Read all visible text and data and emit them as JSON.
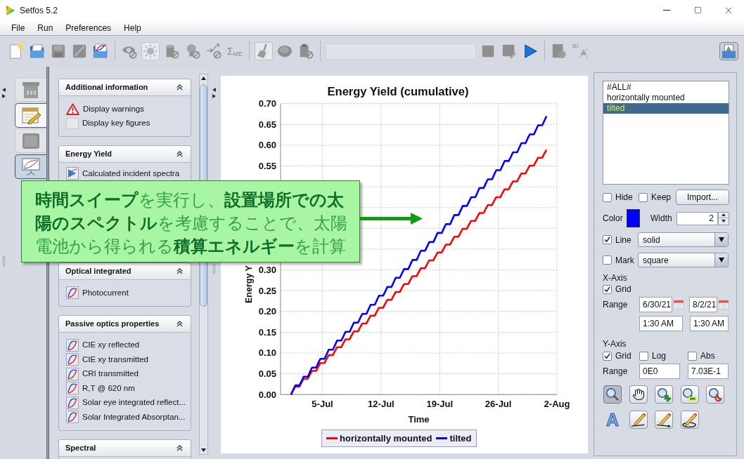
{
  "window": {
    "title": "Setfos 5.2"
  },
  "menu": [
    "File",
    "Run",
    "Preferences",
    "Help"
  ],
  "toolbar": {
    "items": [
      {
        "kind": "button",
        "disabled": false,
        "pressed": false
      },
      {
        "kind": "button",
        "disabled": false,
        "pressed": false
      },
      {
        "kind": "button",
        "disabled": true,
        "pressed": false
      },
      {
        "kind": "button",
        "disabled": true,
        "pressed": false
      },
      {
        "kind": "button",
        "disabled": false,
        "pressed": false
      },
      {
        "kind": "separator"
      },
      {
        "kind": "button",
        "disabled": true,
        "pressed": false
      },
      {
        "kind": "button",
        "disabled": true,
        "pressed": true
      },
      {
        "kind": "button",
        "disabled": true,
        "pressed": false
      },
      {
        "kind": "button",
        "disabled": true,
        "pressed": false
      },
      {
        "kind": "button",
        "disabled": true,
        "pressed": false
      },
      {
        "kind": "button",
        "disabled": true,
        "pressed": false,
        "label": "Σ$_{ME}$"
      },
      {
        "kind": "separator"
      },
      {
        "kind": "button",
        "disabled": true,
        "pressed": true
      },
      {
        "kind": "button",
        "disabled": true,
        "pressed": false
      },
      {
        "kind": "button",
        "disabled": true,
        "pressed": false
      },
      {
        "kind": "separator"
      },
      {
        "kind": "field",
        "disabled": true
      },
      {
        "kind": "button",
        "disabled": true,
        "pressed": false
      },
      {
        "kind": "button",
        "disabled": true,
        "pressed": false
      },
      {
        "kind": "button",
        "disabled": false,
        "pressed": false
      },
      {
        "kind": "separator"
      },
      {
        "kind": "button",
        "disabled": true,
        "pressed": false
      },
      {
        "kind": "button",
        "disabled": true,
        "pressed": false,
        "label": "3D"
      }
    ],
    "right_button": {
      "disabled": false,
      "pressed": true
    }
  },
  "view_tabs": [
    {
      "selected": false,
      "disabled": true
    },
    {
      "selected": false,
      "disabled": false
    },
    {
      "selected": false,
      "disabled": true
    },
    {
      "selected": true,
      "disabled": false
    }
  ],
  "sidebar": {
    "sections": [
      {
        "title": "Additional information",
        "expanded": true,
        "items": [
          {
            "kind": "warning",
            "label": "Display warnings"
          },
          {
            "kind": "blank",
            "label": "Display key figures"
          }
        ]
      },
      {
        "title": "Energy Yield",
        "expanded": true,
        "items": [
          {
            "kind": "spectrum",
            "label": "Calculated incident spectra"
          }
        ]
      },
      {
        "title": "Optical integrated",
        "expanded": true,
        "items": [
          {
            "kind": "plot",
            "label": "Photocurrent"
          }
        ]
      },
      {
        "title": "Passive optics properties",
        "expanded": true,
        "items": [
          {
            "kind": "plot",
            "label": "CIE xy reflected"
          },
          {
            "kind": "plot",
            "label": "CIE xy transmitted"
          },
          {
            "kind": "plot",
            "label": "CRI transmitted"
          },
          {
            "kind": "plot",
            "label": "R,T @ 620 nm"
          },
          {
            "kind": "plot",
            "label": "Solar eye integrated reflect..."
          },
          {
            "kind": "plot",
            "label": "Solar Integrated Absorptan..."
          }
        ]
      },
      {
        "title": "Spectral",
        "expanded": true
      }
    ]
  },
  "chart": {
    "chart_data": {
      "type": "line",
      "title": "Energy Yield (cumulative)",
      "xlabel": "Time",
      "ylabel": "Energy Y",
      "grid": true,
      "legend": "bottom",
      "categories": [
        null,
        null,
        null,
        null,
        null,
        null,
        null,
        null,
        null,
        null,
        null,
        null,
        null,
        null,
        null,
        null,
        null,
        null,
        null,
        null,
        "5-Jul",
        null,
        null,
        null,
        null,
        null,
        null,
        null,
        null,
        null,
        null,
        null,
        null,
        null,
        null,
        null,
        null,
        null,
        null,
        null,
        null,
        null,
        null,
        null,
        null,
        null,
        null,
        null,
        "12-Jul",
        null,
        null,
        null,
        null,
        null,
        null,
        null,
        null,
        null,
        null,
        null,
        null,
        null,
        null,
        null,
        null,
        null,
        null,
        null,
        null,
        null,
        null,
        null,
        null,
        null,
        null,
        null,
        "19-Jul",
        null,
        null,
        null,
        null,
        null,
        null,
        null,
        null,
        null,
        null,
        null,
        null,
        null,
        null,
        null,
        null,
        null,
        null,
        null,
        null,
        null,
        null,
        null,
        null,
        null,
        null,
        null,
        "26-Jul",
        null,
        null,
        null,
        null,
        null,
        null,
        null,
        null,
        null,
        null,
        null,
        null,
        null,
        null,
        null,
        null,
        null,
        null,
        null,
        null,
        null,
        null,
        null,
        null,
        null,
        null,
        null,
        "2-Aug"
      ],
      "series": [
        {
          "name": "horizontally mounted",
          "color": "#ff0000",
          "values": [
            null,
            null,
            null,
            null,
            null,
            0,
            0.01,
            0.019,
            0.019,
            0.019,
            0.029,
            0.038,
            0.038,
            0.038,
            0.048,
            0.057,
            0.057,
            0.057,
            0.067,
            0.076,
            0.076,
            0.076,
            0.086,
            0.095,
            0.095,
            0.095,
            0.105,
            0.114,
            0.114,
            0.114,
            0.124,
            0.133,
            0.133,
            0.133,
            0.143,
            0.152,
            0.152,
            0.152,
            0.162,
            0.171,
            0.171,
            0.171,
            0.181,
            0.19,
            0.19,
            0.19,
            0.2,
            0.209,
            0.209,
            0.209,
            0.219,
            0.228,
            0.228,
            0.228,
            0.238,
            0.247,
            0.247,
            0.247,
            0.257,
            0.266,
            0.266,
            0.266,
            0.276,
            0.285,
            0.285,
            0.285,
            0.295,
            0.304,
            0.304,
            0.304,
            0.314,
            0.323,
            0.323,
            0.323,
            0.333,
            0.342,
            0.342,
            0.342,
            0.352,
            0.361,
            0.361,
            0.361,
            0.371,
            0.38,
            0.38,
            0.38,
            0.39,
            0.399,
            0.399,
            0.399,
            0.409,
            0.418,
            0.418,
            0.418,
            0.428,
            0.437,
            0.437,
            0.437,
            0.447,
            0.456,
            0.456,
            0.456,
            0.466,
            0.475,
            0.475,
            0.475,
            0.485,
            0.494,
            0.494,
            0.494,
            0.504,
            0.513,
            0.513,
            0.513,
            0.523,
            0.532,
            0.532,
            0.532,
            0.542,
            0.551,
            0.551,
            0.551,
            0.561,
            0.57,
            0.57,
            0.57,
            0.58,
            0.589,
            null,
            null,
            null,
            null,
            null
          ]
        },
        {
          "name": "tilted",
          "color": "#0000ff",
          "values": [
            null,
            null,
            null,
            null,
            null,
            0,
            0.011,
            0.022,
            0.022,
            0.022,
            0.032,
            0.043,
            0.043,
            0.043,
            0.054,
            0.065,
            0.065,
            0.065,
            0.076,
            0.086,
            0.086,
            0.086,
            0.097,
            0.108,
            0.108,
            0.108,
            0.119,
            0.13,
            0.13,
            0.13,
            0.14,
            0.151,
            0.151,
            0.151,
            0.162,
            0.173,
            0.173,
            0.173,
            0.184,
            0.194,
            0.194,
            0.194,
            0.205,
            0.216,
            0.216,
            0.216,
            0.227,
            0.238,
            0.238,
            0.238,
            0.248,
            0.259,
            0.259,
            0.259,
            0.27,
            0.281,
            0.281,
            0.281,
            0.292,
            0.302,
            0.302,
            0.302,
            0.313,
            0.324,
            0.324,
            0.324,
            0.335,
            0.346,
            0.346,
            0.346,
            0.356,
            0.367,
            0.367,
            0.367,
            0.378,
            0.389,
            0.389,
            0.389,
            0.4,
            0.41,
            0.41,
            0.41,
            0.421,
            0.432,
            0.432,
            0.432,
            0.443,
            0.454,
            0.454,
            0.454,
            0.464,
            0.475,
            0.475,
            0.475,
            0.486,
            0.497,
            0.497,
            0.497,
            0.508,
            0.518,
            0.518,
            0.518,
            0.529,
            0.54,
            0.54,
            0.54,
            0.551,
            0.562,
            0.562,
            0.562,
            0.572,
            0.583,
            0.583,
            0.583,
            0.594,
            0.605,
            0.605,
            0.605,
            0.616,
            0.626,
            0.626,
            0.626,
            0.637,
            0.648,
            0.648,
            0.648,
            0.659,
            0.67,
            null,
            null,
            null,
            null,
            null
          ]
        }
      ],
      "ylim": [
        0,
        0.7
      ],
      "yticks": [
        {
          "value": 0,
          "label": "0.00"
        },
        {
          "value": 0.05,
          "label": "0.05"
        },
        {
          "value": 0.1,
          "label": "0.10"
        },
        {
          "value": 0.15,
          "label": "0.15"
        },
        {
          "value": 0.2,
          "label": "0.20"
        },
        {
          "value": 0.25,
          "label": "0.25"
        },
        {
          "value": 0.3,
          "label": "0.30"
        },
        {
          "value": 0.55,
          "label": "0.55"
        },
        {
          "value": 0.6,
          "label": "0.60"
        },
        {
          "value": 0.65,
          "label": "0.65"
        },
        {
          "value": 0.7,
          "label": "0.70"
        }
      ]
    }
  },
  "callout": {
    "text": "**時間スイープ**を実行し、**設置場所での太陽のスペクトル**を考慮することで、太陽電池から得られる**積算エネルギー**を計算"
  },
  "series_panel": {
    "series_list": [
      {
        "label": "#ALL#",
        "selected": false
      },
      {
        "label": "horizontally mounted",
        "selected": false
      },
      {
        "label": "tilted",
        "selected": true
      }
    ],
    "hide": {
      "label": "Hide",
      "checked": false
    },
    "keep": {
      "label": "Keep",
      "checked": false
    },
    "import_button": "Import...",
    "color_field": {
      "label": "Color",
      "color": "#0000ff"
    },
    "width": {
      "label": "Width",
      "value": "2"
    },
    "line": {
      "label": "Line",
      "checked": true,
      "value": "solid"
    },
    "mark": {
      "label": "Mark",
      "checked": false,
      "value": "square"
    },
    "x_axis": {
      "title": "X-Axis",
      "grid": {
        "label": "Grid",
        "checked": true
      },
      "range_label": "Range",
      "from_date": "6/30/21",
      "to_date": "8/2/21",
      "from_time": "1:30 AM",
      "to_time": "1:30 AM"
    },
    "y_axis": {
      "title": "Y-Axis",
      "grid": {
        "label": "Grid",
        "checked": true
      },
      "log": {
        "label": "Log",
        "checked": false
      },
      "abs": {
        "label": "Abs",
        "checked": false
      },
      "range_label": "Range",
      "min": "0E0",
      "max": "7.03E-1"
    },
    "zoom_tools": [
      {
        "selected": true
      },
      {
        "selected": false
      },
      {
        "selected": false
      },
      {
        "selected": false
      },
      {
        "selected": false
      }
    ],
    "text_tool": "A"
  }
}
